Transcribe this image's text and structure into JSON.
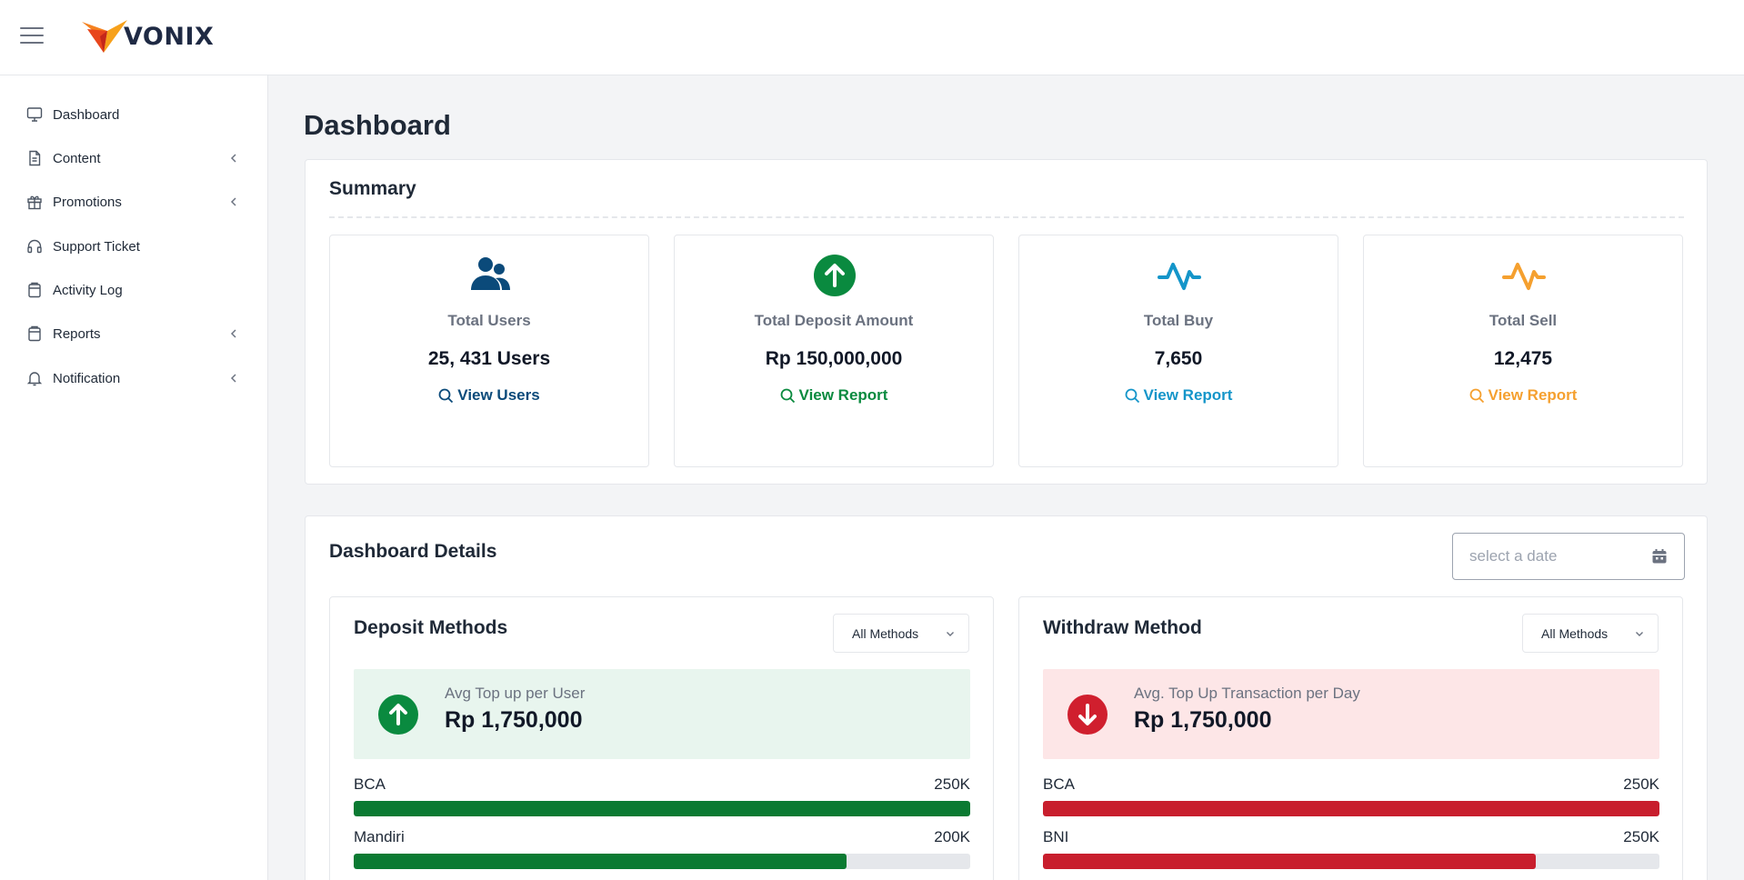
{
  "app": {
    "brand": "VONIX"
  },
  "colors": {
    "users": "#0b4a7a",
    "deposit": "#0a8a3f",
    "buy": "#1495c9",
    "sell": "#f5a02f",
    "deposit_bar": "#0b7a32",
    "withdraw_bar": "#c81e2d",
    "deposit_banner_bg": "#e8f5ee",
    "withdraw_banner_bg": "#fde6e7",
    "withdraw_icon": "#d01f2e"
  },
  "sidebar": {
    "items": [
      {
        "label": "Dashboard",
        "icon": "monitor-icon",
        "has_submenu": false
      },
      {
        "label": "Content",
        "icon": "document-icon",
        "has_submenu": true
      },
      {
        "label": "Promotions",
        "icon": "gift-icon",
        "has_submenu": true
      },
      {
        "label": "Support Ticket",
        "icon": "headset-icon",
        "has_submenu": false
      },
      {
        "label": "Activity Log",
        "icon": "clipboard-icon",
        "has_submenu": false
      },
      {
        "label": "Reports",
        "icon": "clipboard-icon",
        "has_submenu": true
      },
      {
        "label": "Notification",
        "icon": "bell-icon",
        "has_submenu": true
      }
    ]
  },
  "page": {
    "title": "Dashboard"
  },
  "summary": {
    "title": "Summary",
    "stats": [
      {
        "label": "Total Users",
        "value": "25, 431 Users",
        "link": "View Users",
        "icon": "users-icon"
      },
      {
        "label": "Total Deposit Amount",
        "value": "Rp 150,000,000",
        "link": "View Report",
        "icon": "arrow-up-circle-icon"
      },
      {
        "label": "Total Buy",
        "value": "7,650",
        "link": "View Report",
        "icon": "pulse-icon"
      },
      {
        "label": "Total Sell",
        "value": "12,475",
        "link": "View Report",
        "icon": "pulse-icon"
      }
    ]
  },
  "details": {
    "title": "Dashboard Details",
    "date_placeholder": "select a date",
    "deposit": {
      "title": "Deposit Methods",
      "filter": "All Methods",
      "banner_label": "Avg Top up per User",
      "banner_value": "Rp 1,750,000",
      "bars": [
        {
          "name": "BCA",
          "value": "250K",
          "fraction": 1.0
        },
        {
          "name": "Mandiri",
          "value": "200K",
          "fraction": 0.8
        }
      ]
    },
    "withdraw": {
      "title": "Withdraw Method",
      "filter": "All Methods",
      "banner_label": "Avg. Top Up Transaction per Day",
      "banner_value": "Rp 1,750,000",
      "bars": [
        {
          "name": "BCA",
          "value": "250K",
          "fraction": 1.0
        },
        {
          "name": "BNI",
          "value": "250K",
          "fraction": 0.8
        }
      ]
    }
  }
}
